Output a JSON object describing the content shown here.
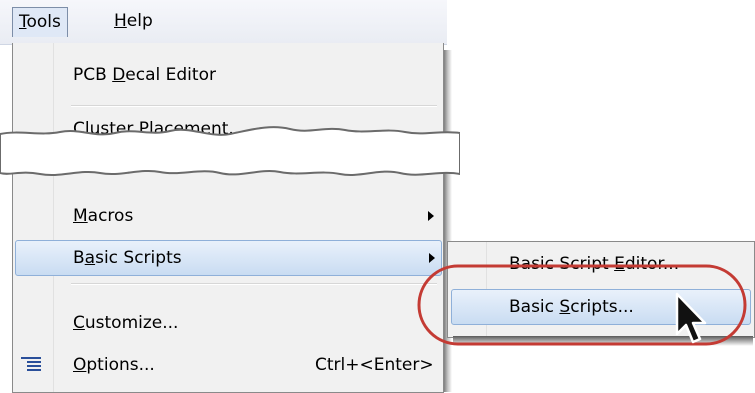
{
  "menubar": {
    "tools": {
      "label": "Tools",
      "hotkey": "T",
      "rest": "ools"
    },
    "help": {
      "label": "Help",
      "hotkey": "H",
      "rest": "elp"
    }
  },
  "tools_menu": {
    "pcb_decal_editor": {
      "pre": "PCB ",
      "hotkey": "D",
      "post": "ecal Editor"
    },
    "cluster_placement": {
      "label": "Cluster Placement..."
    },
    "macros": {
      "pre": "",
      "hotkey": "M",
      "post": "acros"
    },
    "basic_scripts": {
      "pre": "B",
      "hotkey": "a",
      "post": "sic Scripts"
    },
    "customize": {
      "pre": "",
      "hotkey": "C",
      "post": "ustomize..."
    },
    "options": {
      "pre": "",
      "hotkey": "O",
      "post": "ptions...",
      "shortcut": "Ctrl+<Enter>"
    }
  },
  "submenu": {
    "editor": {
      "pre": "Basic Script ",
      "hotkey": "E",
      "post": "ditor..."
    },
    "scripts": {
      "pre": "Basic ",
      "hotkey": "S",
      "post": "cripts..."
    }
  },
  "colors": {
    "highlight": "#c9dcf2",
    "callout": "#c43b34",
    "menu_bg": "#f1f1f1"
  },
  "icons": [
    "options-icon",
    "submenu-arrow-icon",
    "mouse-cursor-icon"
  ]
}
